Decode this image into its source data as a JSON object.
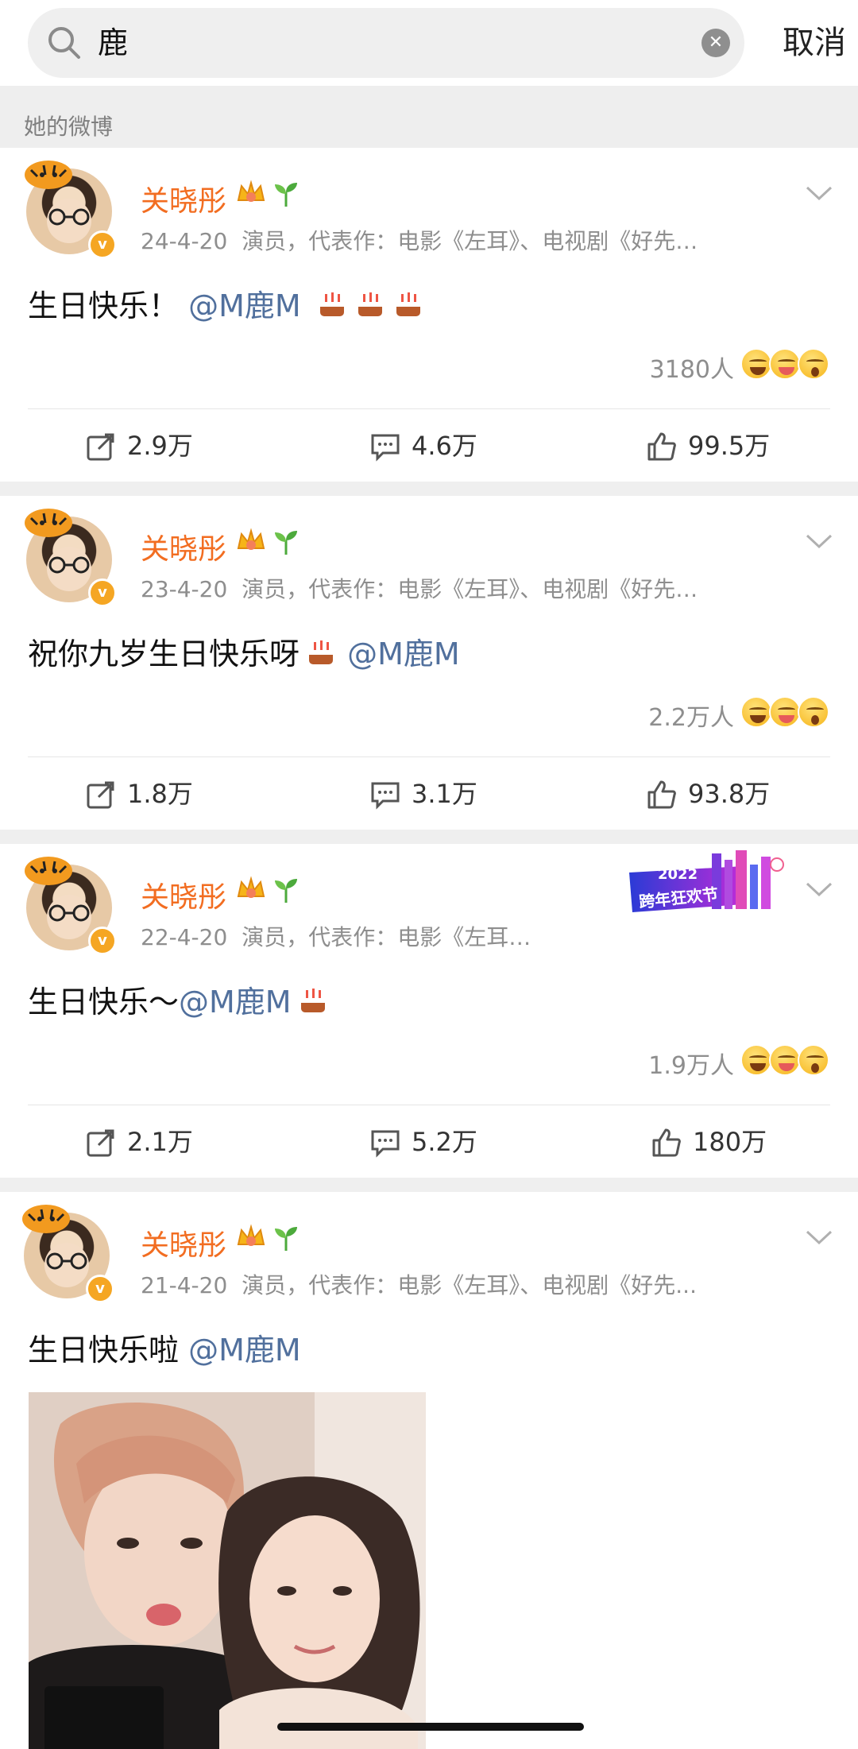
{
  "search": {
    "query": "鹿",
    "cancel_label": "取消"
  },
  "section": {
    "label": "她的微博"
  },
  "user": {
    "name": "关晓彤",
    "meta_description": "演员，代表作：电影《左耳》、电视剧《好先…",
    "meta_description_short": "演员，代表作：电影《左耳…",
    "meta_description_alt": "演员，代表作：电影《左耳》、电视剧《好先..."
  },
  "posts": [
    {
      "date": "24-4-20",
      "text": "生日快乐！",
      "mention": "@M鹿M",
      "reactions": "3180人",
      "reposts": "2.9万",
      "comments": "4.6万",
      "likes": "99.5万"
    },
    {
      "date": "23-4-20",
      "text": "祝你九岁生日快乐呀",
      "mention": "@M鹿M",
      "reactions": "2.2万人",
      "reposts": "1.8万",
      "comments": "3.1万",
      "likes": "93.8万"
    },
    {
      "date": "22-4-20",
      "text": "生日快乐～",
      "mention": "@M鹿M",
      "reactions": "1.9万人",
      "reposts": "2.1万",
      "comments": "5.2万",
      "likes": "180万",
      "banner_year": "2022",
      "banner_text": "跨年狂欢节"
    },
    {
      "date": "21-4-20",
      "text": "生日快乐啦",
      "mention": "@M鹿M"
    }
  ],
  "icons": {
    "search": "search-icon",
    "clear": "clear-icon",
    "chevron": "chevron-down-icon",
    "repost": "repost-icon",
    "comment": "comment-icon",
    "like": "like-icon",
    "cake": "cake-icon",
    "crown": "crown-icon",
    "sprout": "sprout-icon",
    "verified": "verified-icon"
  },
  "colors": {
    "username": "#f26d21",
    "mention": "#51709d",
    "meta": "#8e8e8e",
    "separator": "#efefef"
  }
}
